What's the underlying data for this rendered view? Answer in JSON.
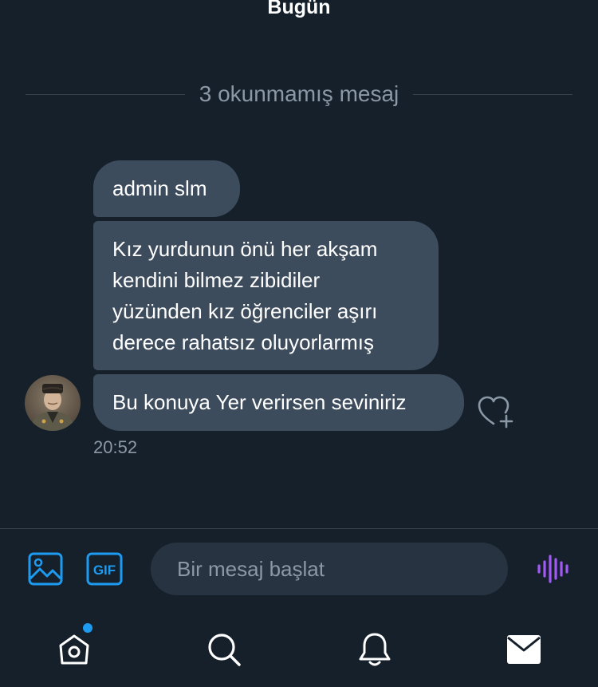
{
  "conversation": {
    "day_label": "Bugün",
    "unread_divider": "3 okunmamış mesaj",
    "messages": [
      {
        "text": "admin slm"
      },
      {
        "text": "Kız yurdunun önü her akşam\nkendini bilmez zibidiler\nyüzünden kız öğrenciler aşırı\nderece rahatsız oluyorlarmış"
      },
      {
        "text": "Bu konuya Yer verirsen seviniriz"
      }
    ],
    "timestamp": "20:52",
    "sender_avatar": "user-avatar",
    "react_icon": "heart-plus-icon"
  },
  "composer": {
    "placeholder": "Bir mesaj başlat",
    "media_icon": "image-icon",
    "gif_label": "GIF",
    "voice_icon": "voice-waveform-icon"
  },
  "nav": {
    "items": [
      {
        "icon": "home-icon",
        "has_notification_dot": true
      },
      {
        "icon": "search-icon"
      },
      {
        "icon": "bell-icon"
      },
      {
        "icon": "mail-icon",
        "active": true
      }
    ]
  },
  "colors": {
    "background": "#15202b",
    "bubble": "#3d4c5c",
    "accent": "#1d9bf0",
    "voice": "#a259f5",
    "muted_text": "#8b98a5",
    "divider": "#38444d",
    "input_background": "#273340"
  }
}
